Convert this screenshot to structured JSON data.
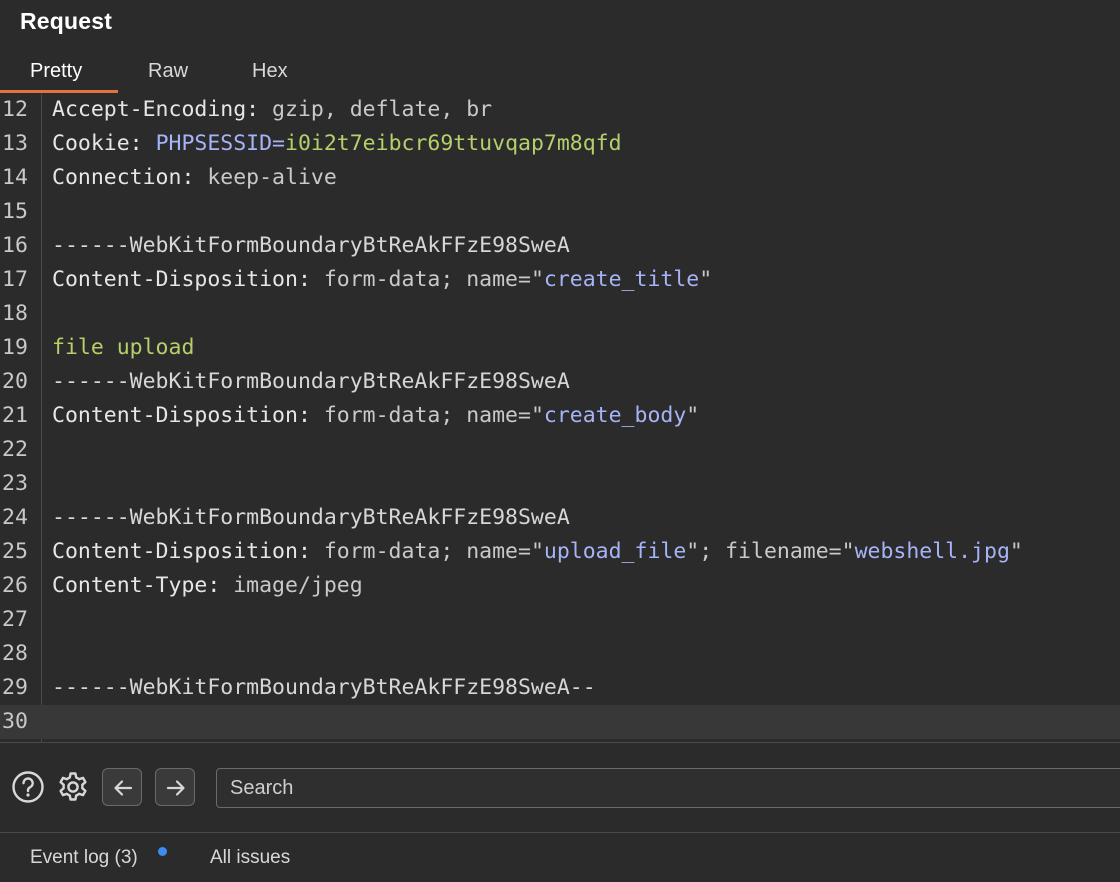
{
  "panel": {
    "title": "Request"
  },
  "tabs": [
    {
      "label": "Pretty",
      "active": true
    },
    {
      "label": "Raw",
      "active": false
    },
    {
      "label": "Hex",
      "active": false
    }
  ],
  "lines": [
    {
      "n": "12",
      "segs": [
        {
          "t": "Accept-Encoding:",
          "c": "hdr-key"
        },
        {
          "t": " gzip, deflate, br",
          "c": "hdr-val"
        }
      ]
    },
    {
      "n": "13",
      "segs": [
        {
          "t": "Cookie:",
          "c": "hdr-key"
        },
        {
          "t": " ",
          "c": "plain"
        },
        {
          "t": "PHPSESSID=",
          "c": "cookie-name"
        },
        {
          "t": "i0i2t7eibcr69ttuvqap7m8qfd",
          "c": "cookie-val"
        }
      ]
    },
    {
      "n": "14",
      "segs": [
        {
          "t": "Connection:",
          "c": "hdr-key"
        },
        {
          "t": " keep-alive",
          "c": "hdr-val"
        }
      ]
    },
    {
      "n": "15",
      "segs": []
    },
    {
      "n": "16",
      "segs": [
        {
          "t": "------WebKitFormBoundaryBtReAkFFzE98SweA",
          "c": "boundary"
        }
      ]
    },
    {
      "n": "17",
      "segs": [
        {
          "t": "Content-Disposition:",
          "c": "hdr-key"
        },
        {
          "t": " form-data; name=\"",
          "c": "hdr-val"
        },
        {
          "t": "create_title",
          "c": "str"
        },
        {
          "t": "\"",
          "c": "hdr-val"
        }
      ]
    },
    {
      "n": "18",
      "segs": []
    },
    {
      "n": "19",
      "segs": [
        {
          "t": "file upload",
          "c": "body-text"
        }
      ]
    },
    {
      "n": "20",
      "segs": [
        {
          "t": "------WebKitFormBoundaryBtReAkFFzE98SweA",
          "c": "boundary"
        }
      ]
    },
    {
      "n": "21",
      "segs": [
        {
          "t": "Content-Disposition:",
          "c": "hdr-key"
        },
        {
          "t": " form-data; name=\"",
          "c": "hdr-val"
        },
        {
          "t": "create_body",
          "c": "str"
        },
        {
          "t": "\"",
          "c": "hdr-val"
        }
      ]
    },
    {
      "n": "22",
      "segs": []
    },
    {
      "n": "23",
      "segs": []
    },
    {
      "n": "24",
      "segs": [
        {
          "t": "------WebKitFormBoundaryBtReAkFFzE98SweA",
          "c": "boundary"
        }
      ]
    },
    {
      "n": "25",
      "segs": [
        {
          "t": "Content-Disposition:",
          "c": "hdr-key"
        },
        {
          "t": " form-data; name=\"",
          "c": "hdr-val"
        },
        {
          "t": "upload_file",
          "c": "str"
        },
        {
          "t": "\"; filename=\"",
          "c": "hdr-val"
        },
        {
          "t": "webshell.jpg",
          "c": "str"
        },
        {
          "t": "\"",
          "c": "hdr-val"
        }
      ]
    },
    {
      "n": "26",
      "segs": [
        {
          "t": "Content-Type:",
          "c": "hdr-key"
        },
        {
          "t": " image/jpeg",
          "c": "hdr-val"
        }
      ]
    },
    {
      "n": "27",
      "segs": []
    },
    {
      "n": "28",
      "segs": []
    },
    {
      "n": "29",
      "segs": [
        {
          "t": "------WebKitFormBoundaryBtReAkFFzE98SweA--",
          "c": "boundary"
        }
      ]
    },
    {
      "n": "30",
      "segs": [],
      "current": true
    }
  ],
  "toolbar": {
    "help_icon": "question-circle-icon",
    "settings_icon": "gear-icon",
    "back_icon": "arrow-left-icon",
    "forward_icon": "arrow-right-icon",
    "search_placeholder": "Search"
  },
  "statusbar": {
    "event_log": "Event log (3)",
    "all_issues": "All issues",
    "notification_color": "#3f8cf0"
  },
  "colors": {
    "background": "#2b2b2b",
    "accent_underline": "#e0733f",
    "string_blue": "#a6b4f7",
    "value_green": "#b5cf6b"
  }
}
